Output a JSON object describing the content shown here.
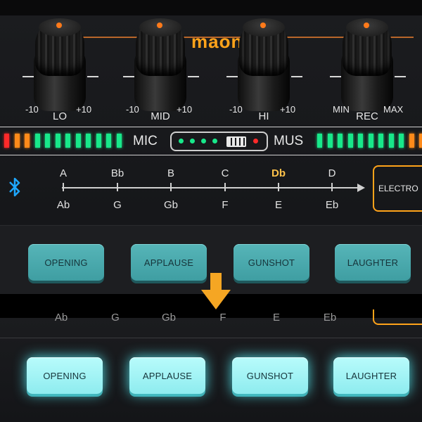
{
  "brand": "maon",
  "knobs": [
    {
      "label": "LO",
      "min": "-10",
      "max": "+10"
    },
    {
      "label": "MID",
      "min": "-10",
      "max": "+10"
    },
    {
      "label": "HI",
      "min": "-10",
      "max": "+10"
    },
    {
      "label": "REC",
      "min": "MIN",
      "max": "MAX"
    }
  ],
  "meter": {
    "mic_label": "MIC",
    "mus_label": "MUS",
    "left_colors": [
      "#ff2a2a",
      "#ff8a1a",
      "#ff8a1a",
      "#18e88a",
      "#18e88a",
      "#18e88a",
      "#18e88a",
      "#18e88a",
      "#18e88a",
      "#18e88a",
      "#18e88a",
      "#18e88a"
    ],
    "right_colors": [
      "#18e88a",
      "#18e88a",
      "#18e88a",
      "#18e88a",
      "#18e88a",
      "#18e88a",
      "#18e88a",
      "#18e88a",
      "#18e88a",
      "#ff8a1a",
      "#ff8a1a",
      "#ff2a2a"
    ]
  },
  "notes_top": [
    "A",
    "Bb",
    "B",
    "C",
    "Db",
    "D"
  ],
  "notes_bottom": [
    "Ab",
    "G",
    "Gb",
    "F",
    "E",
    "Eb"
  ],
  "selected_note": "Db",
  "effect_button": "ELECTRO",
  "pads": [
    "OPENING",
    "APPLAUSE",
    "GUNSHOT",
    "LAUGHTER"
  ],
  "lower_notes": [
    "Ab",
    "G",
    "Gb",
    "F",
    "E",
    "Eb"
  ],
  "colors": {
    "accent_orange": "#ffa31a",
    "bluetooth_blue": "#1ea7ff",
    "pad_teal": "#8eecef",
    "arrow_orange": "#f5a623"
  }
}
